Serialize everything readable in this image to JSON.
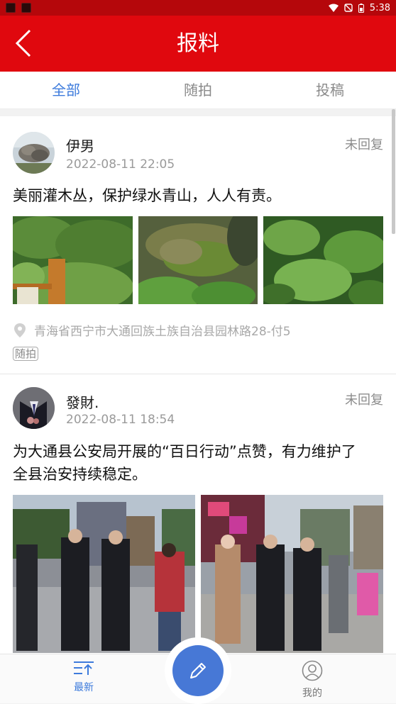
{
  "status_bar": {
    "time": "5:38"
  },
  "header": {
    "title": "报料"
  },
  "tabs": [
    {
      "label": "全部",
      "active": true
    },
    {
      "label": "随拍",
      "active": false
    },
    {
      "label": "投稿",
      "active": false
    }
  ],
  "posts": [
    {
      "username": "伊男",
      "status": "未回复",
      "time": "2022-08-11 22:05",
      "text": "美丽灌木丛，保护绿水青山，人人有责。",
      "location": "青海省西宁市大通回族土族自治县园林路28-付5",
      "tag": "随拍"
    },
    {
      "username": "發財.",
      "status": "未回复",
      "time": "2022-08-11 18:54",
      "text_line1": "为大通县公安局开展的“百日行动”点赞，有力维护了",
      "text_line2": "全县治安持续稳定。"
    }
  ],
  "bottom_nav": {
    "latest": "最新",
    "mine": "我的"
  },
  "colors": {
    "header_red": "#e0080e",
    "status_red": "#b5070b",
    "accent_blue": "#3d7bdc",
    "fab_blue": "#4778d6"
  }
}
